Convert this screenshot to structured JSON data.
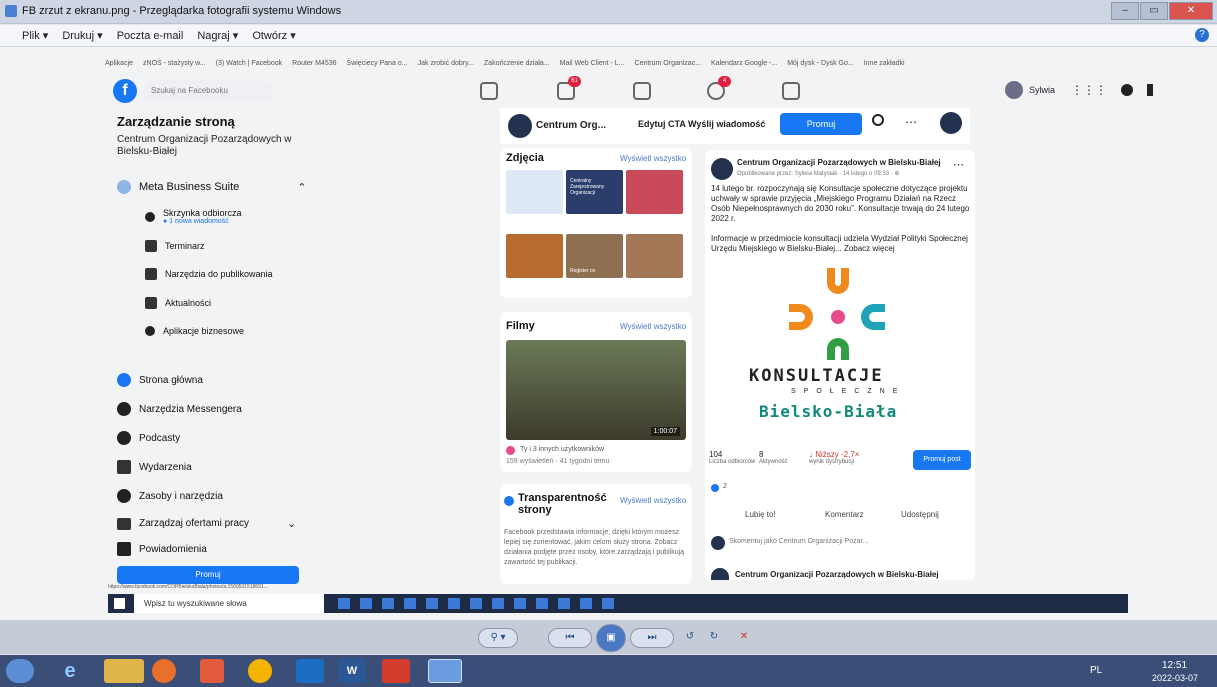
{
  "window": {
    "title": "FB zrzut z ekranu.png - Przeglądarka fotografii systemu Windows",
    "btn_min": "–",
    "btn_max": "▭",
    "btn_close": "✕"
  },
  "menu": {
    "items": [
      "Plik ▾",
      "Drukuj ▾",
      "Poczta e-mail",
      "Nagraj ▾",
      "Otwórz ▾"
    ],
    "help": "?"
  },
  "photo": {
    "bookmarks": [
      "Aplikacje",
      "zNOŚ - stażysty w...",
      "(3) Watch | Facebook",
      "Router M4536",
      "Święciecy Pana o...",
      "Jak zrobić dobry...",
      "Zakończenie działa...",
      "Mail Web Client - L...",
      "Centrum Organizac...",
      "Kalendarz Google -...",
      "Mój dysk - Dysk Go...",
      "Inne zakładki"
    ],
    "fb": {
      "logo": "f",
      "search_placeholder": "Szukaj na Facebooku",
      "msg_badge": "61",
      "notif_badge": "4",
      "user": "Sylwia",
      "left": {
        "title": "Zarządzanie stroną",
        "page_name": "Centrum Organizacji Pozarządowych w Bielsku-Białej",
        "mbs": "Meta Business Suite",
        "sub": [
          {
            "label": "Skrzynka odbiorcza",
            "note": "● 1 nowa wiadomość"
          },
          {
            "label": "Terminarz"
          },
          {
            "label": "Narzędzia do publikowania"
          },
          {
            "label": "Aktualności"
          },
          {
            "label": "Aplikacje biznesowe"
          }
        ],
        "nav": [
          "Strona główna",
          "Narzędzia Messengera",
          "Podcasty",
          "Wydarzenia",
          "Zasoby i narzędzia",
          "Zarządzaj ofertami pracy",
          "Powiadomienia"
        ],
        "promote": "Promuj"
      },
      "header": {
        "page_short": "Centrum Org...",
        "edit_cta": "Edytuj CTA Wyślij wiadomość",
        "promote": "Promuj"
      },
      "photos": {
        "title": "Zdjęcia",
        "see_all": "Wyświetl wszystko",
        "thumb_text": "Centralny Zarejestrowany Organizacji",
        "thumb_text2": "Register on"
      },
      "videos": {
        "title": "Filmy",
        "see_all": "Wyświetl wszystko",
        "duration": "1:00:07",
        "reactions": "Ty i 3 innych użytkowników",
        "views": "159 wyświetleń · 41 tygodni temu"
      },
      "transparency": {
        "title": "Transparentność strony",
        "see_all": "Wyświetl wszystko",
        "text": "Facebook przedstawia informacje, dzięki którym możesz lepiej się zorientować, jakim celom służy strona. Zobacz działania podjęte przez osoby, które zarządzają i publikują zawartość tej publikacji."
      },
      "post": {
        "author": "Centrum Organizacji Pozarządowych w Bielsku-Białej",
        "meta": "Opublikowane przez: Sylwia Matysiak · 14 lutego o 09:33 · ⊕",
        "text1": "14 lutego br. rozpoczynają się Konsultacje społeczne dotyczące projektu uchwały w sprawie przyjęcia „Miejskiego Programu Działań na Rzecz Osób Niepełnosprawnych do 2030 roku”. Konsultacje trwają do 24 lutego 2022 r.",
        "text2": "Informacje w przedmiocie konsultacji udziela Wydział Polityki Społecznej Urzędu Miejskiego w Bielsku-Białej... Zobacz więcej",
        "logo_line1": "KONSULTACJE",
        "logo_line2": "SPOŁECZNE",
        "logo_line3": "Bielsko-Biała",
        "stats": [
          {
            "val": "104",
            "label": "Liczba odbiorców"
          },
          {
            "val": "8",
            "label": "Aktywność"
          },
          {
            "val": "↓ Niższy -2,7×",
            "label": "wynik dystrybucji"
          }
        ],
        "promote_post": "Promuj post",
        "reactions_count": "2",
        "actions": [
          "Lubię to!",
          "Komentarz",
          "Udostępnij"
        ],
        "comment_placeholder": "Skomentuj jako Centrum Organizacji Pozar...",
        "next_author": "Centrum Organizacji Pozarządowych w Bielsku-Białej"
      },
      "status_url": "https://www.facebook.com/COPBielskoBiala/photos/a.1500531518691..."
    },
    "taskbar": {
      "search": "Wpisz tu wyszukiwane słowa"
    }
  },
  "viewer": {
    "zoom": "⚲ ▾",
    "prev": "⏮",
    "play": "▣",
    "next": "⏭",
    "rotl": "↺",
    "rotr": "↻",
    "del": "✕"
  },
  "os_taskbar": {
    "lang": "PL",
    "time": "12:51",
    "date": "2022-03-07"
  },
  "colors": {
    "fb_blue": "#1877f2",
    "logo_orange": "#f08a1c",
    "logo_green": "#2f9e44",
    "logo_teal": "#1ea3b8",
    "logo_pink": "#e84b8a",
    "logo_city": "#0f8a7a"
  }
}
